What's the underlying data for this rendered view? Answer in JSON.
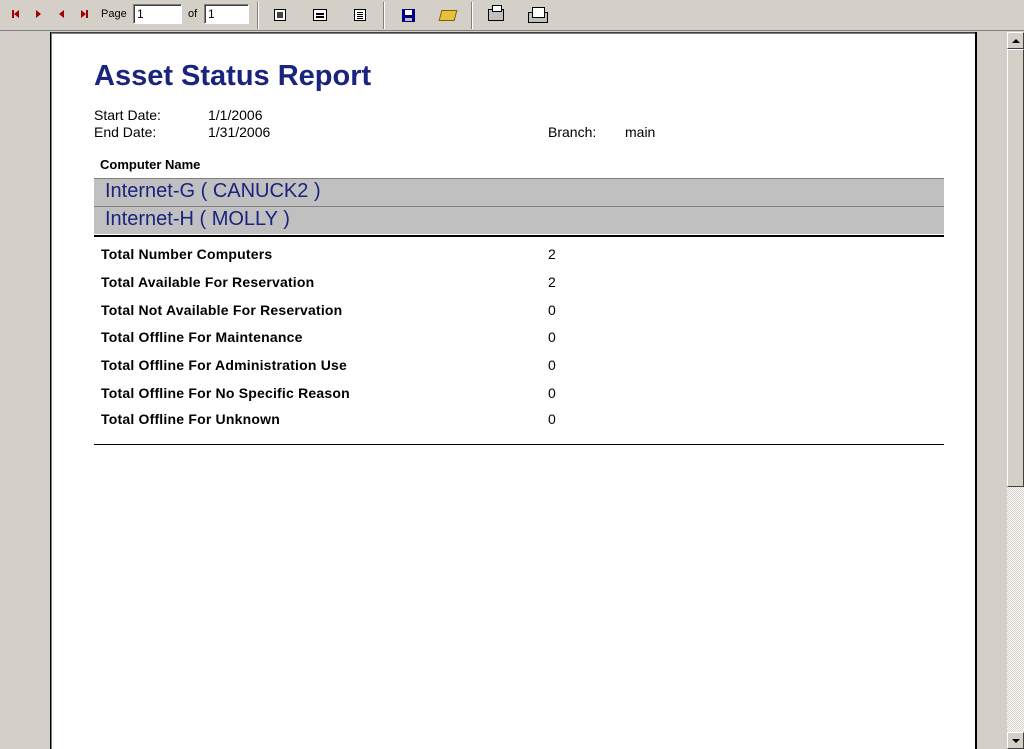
{
  "toolbar": {
    "page_label": "Page",
    "page_value": "1",
    "of_label": "of",
    "total_pages": "1",
    "icons": [
      "first-page-icon",
      "next-page-icon",
      "previous-page-icon",
      "last-page-icon",
      "page-width-icon",
      "whole-page-icon",
      "multiple-pages-icon",
      "save-icon",
      "open-icon",
      "print-icon",
      "export-icon"
    ]
  },
  "report": {
    "title": "Asset Status Report",
    "start_date_label": "Start Date:",
    "start_date": "1/1/2006",
    "end_date_label": "End Date:",
    "end_date": "1/31/2006",
    "branch_label": "Branch:",
    "branch": "main",
    "column_header": "Computer Name",
    "computers": [
      "Internet-G ( CANUCK2 )",
      "Internet-H ( MOLLY )"
    ],
    "totals": [
      {
        "label": "Total Number Computers",
        "value": "2"
      },
      {
        "label": "Total Available For Reservation",
        "value": "2"
      },
      {
        "label": "Total Not Available For Reservation",
        "value": "0"
      },
      {
        "label": "Total Offline For Maintenance",
        "value": "0"
      },
      {
        "label": "Total Offline For Administration Use",
        "value": "0"
      },
      {
        "label": "Total Offline For No Specific Reason",
        "value": "0"
      },
      {
        "label": "Total Offline For Unknown",
        "value": "0"
      }
    ]
  },
  "colors": {
    "title": "#1a237e",
    "group_row": "#c0c0c0",
    "nav_arrows": "#a00000"
  }
}
